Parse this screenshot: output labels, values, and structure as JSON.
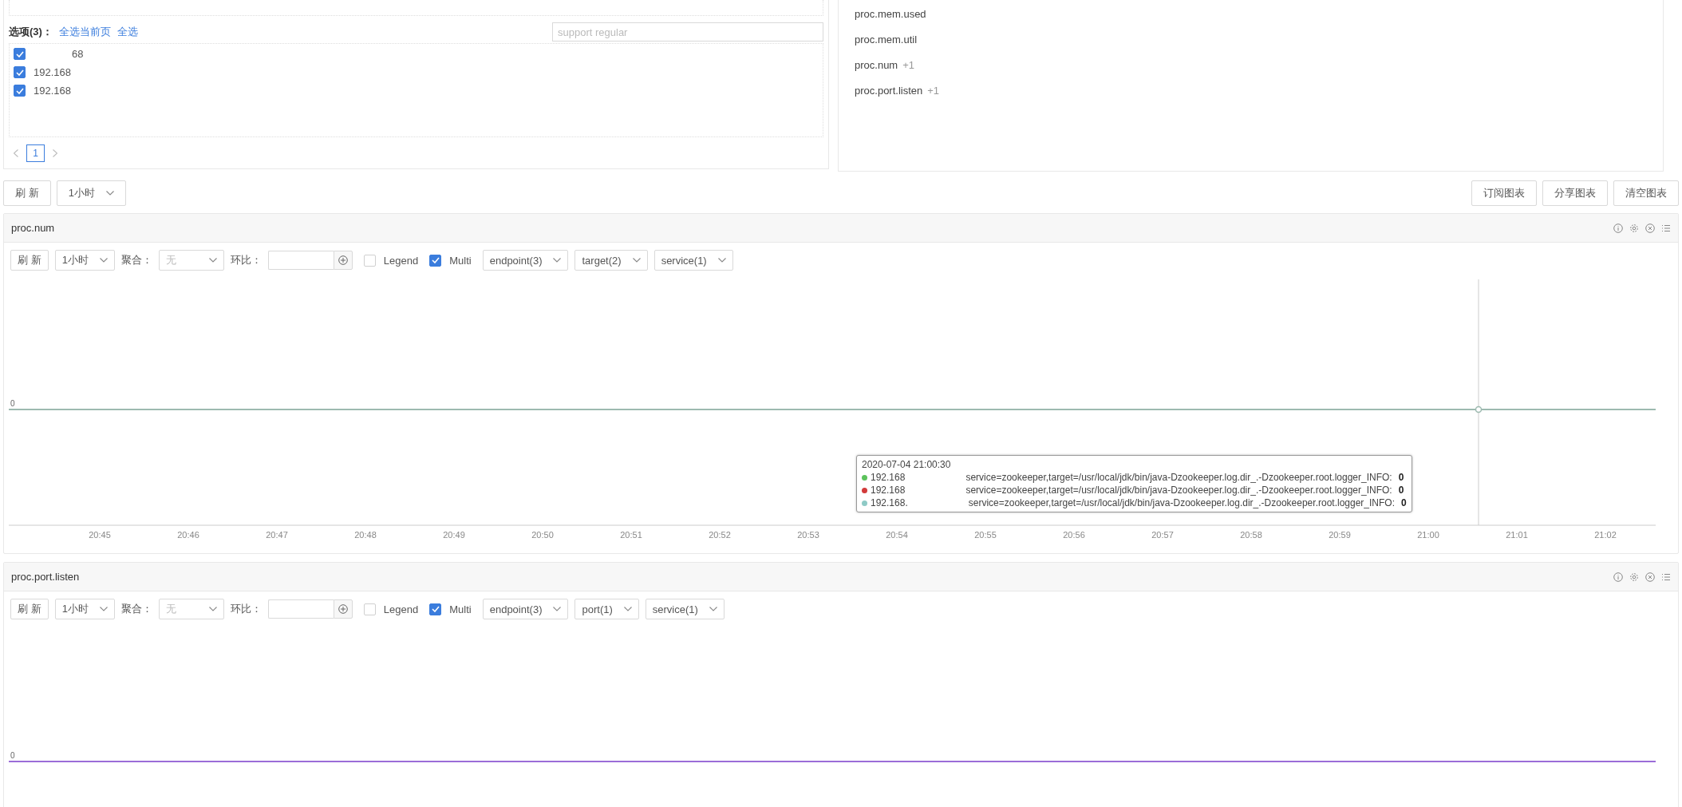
{
  "selector": {
    "title": "选项(3)：",
    "actions": [
      "全选当前页",
      "全选"
    ],
    "search": {
      "placeholder": "support regular"
    },
    "items": [
      {
        "label": "68",
        "checked": true
      },
      {
        "label": "192.168",
        "checked": true
      },
      {
        "label": "192.168",
        "checked": true
      }
    ],
    "pages": [
      {
        "label": "1",
        "selected": true
      }
    ]
  },
  "metrics": [
    {
      "name": "proc.mem.used"
    },
    {
      "name": "proc.mem.util"
    },
    {
      "name": "proc.num",
      "count": "+1"
    },
    {
      "name": "proc.port.listen",
      "count": "+1"
    }
  ],
  "toolbar": {
    "refresh": "刷 新",
    "range": "1小时",
    "actions": [
      "订阅图表",
      "分享图表",
      "清空图表"
    ]
  },
  "charts": [
    {
      "title": "proc.num",
      "controls": {
        "refresh": "刷 新",
        "range": "1小时",
        "aggregate_label": "聚合：",
        "aggregate": {
          "value": "无",
          "disabled": true
        },
        "compare_label": "环比：",
        "legend": {
          "label": "Legend",
          "checked": false
        },
        "multi": {
          "label": "Multi",
          "checked": true
        },
        "filters": [
          "endpoint(3)",
          "target(2)",
          "service(1)"
        ]
      },
      "y_label": "0",
      "x_labels": [
        "20:45",
        "20:46",
        "20:47",
        "20:48",
        "20:49",
        "20:50",
        "20:51",
        "20:52",
        "20:53",
        "20:54",
        "20:55",
        "20:56",
        "20:57",
        "20:58",
        "20:59",
        "21:00",
        "21:01",
        "21:02"
      ],
      "tooltip": {
        "time": "2020-07-04 21:00:30",
        "items": [
          {
            "label": "192.168",
            "series": "service=zookeeper,target=/usr/local/jdk/bin/java-Dzookeeper.log.dir_.-Dzookeeper.root.logger_INFO:",
            "value": "0",
            "color": "#5cc25c"
          },
          {
            "label": "192.168",
            "series": "service=zookeeper,target=/usr/local/jdk/bin/java-Dzookeeper.log.dir_.-Dzookeeper.root.logger_INFO:",
            "value": "0",
            "color": "#d23b3b"
          },
          {
            "label": "192.168.",
            "series": "service=zookeeper,target=/usr/local/jdk/bin/java-Dzookeeper.log.dir_.-Dzookeeper.root.logger_INFO:",
            "value": "0",
            "color": "#8ecac6"
          }
        ]
      }
    },
    {
      "title": "proc.port.listen",
      "controls": {
        "refresh": "刷 新",
        "range": "1小时",
        "aggregate_label": "聚合：",
        "aggregate": {
          "value": "无",
          "disabled": true
        },
        "compare_label": "环比：",
        "legend": {
          "label": "Legend",
          "checked": false
        },
        "multi": {
          "label": "Multi",
          "checked": true
        },
        "filters": [
          "endpoint(3)",
          "port(1)",
          "service(1)"
        ]
      },
      "y_label": "0"
    }
  ]
}
